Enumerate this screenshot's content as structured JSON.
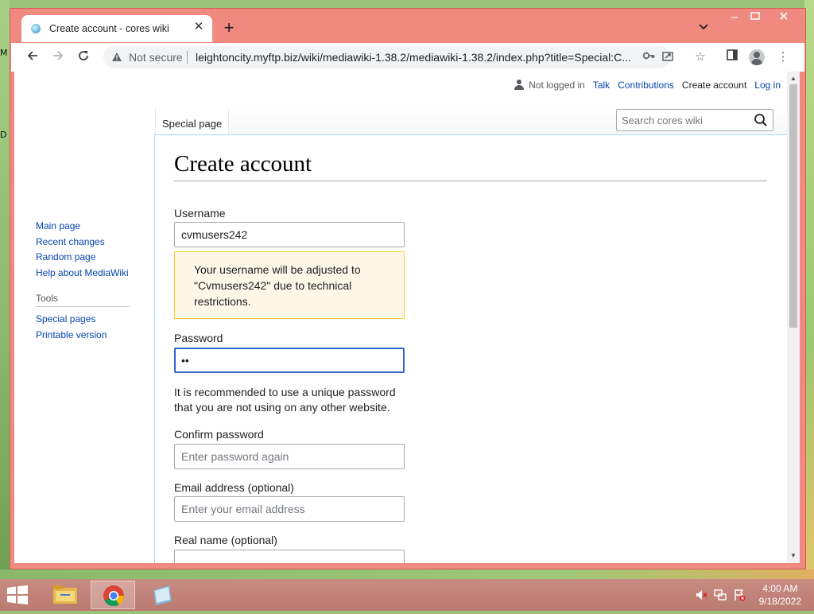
{
  "desktop": {
    "letters": [
      "M",
      "D"
    ]
  },
  "browser": {
    "tab_title": "Create account - cores wiki",
    "new_tab_symbol": "+",
    "omnibox": {
      "security_label": "Not secure",
      "url": "leightoncity.myftp.biz/wiki/mediawiki-1.38.2/mediawiki-1.38.2/index.php?title=Special:C..."
    }
  },
  "wiki": {
    "personal": {
      "status": "Not logged in",
      "talk": "Talk",
      "contributions": "Contributions",
      "create_account": "Create account",
      "login": "Log in"
    },
    "page_tab": "Special page",
    "search_placeholder": "Search cores wiki",
    "sidebar": {
      "navigation": [
        "Main page",
        "Recent changes",
        "Random page",
        "Help about MediaWiki"
      ],
      "tools_heading": "Tools",
      "tools": [
        "Special pages",
        "Printable version"
      ]
    },
    "form": {
      "heading": "Create account",
      "username_label": "Username",
      "username_value": "cvmusers242",
      "username_notice": "Your username will be adjusted to \"Cvmusers242\" due to technical restrictions.",
      "password_label": "Password",
      "password_value": "••",
      "password_help": "It is recommended to use a unique password that you are not using on any other website.",
      "confirm_label": "Confirm password",
      "confirm_placeholder": "Enter password again",
      "email_label": "Email address (optional)",
      "email_placeholder": "Enter your email address",
      "realname_label": "Real name (optional)"
    }
  },
  "taskbar": {
    "time": "4:00 AM",
    "date": "9/18/2022"
  },
  "colors": {
    "window_frame": "#f08a80",
    "link": "#0645ad",
    "focus_border": "#3366cc",
    "notice_bg": "#fef6e7",
    "notice_border": "#ffcc33",
    "taskbar": "#c98c82"
  }
}
